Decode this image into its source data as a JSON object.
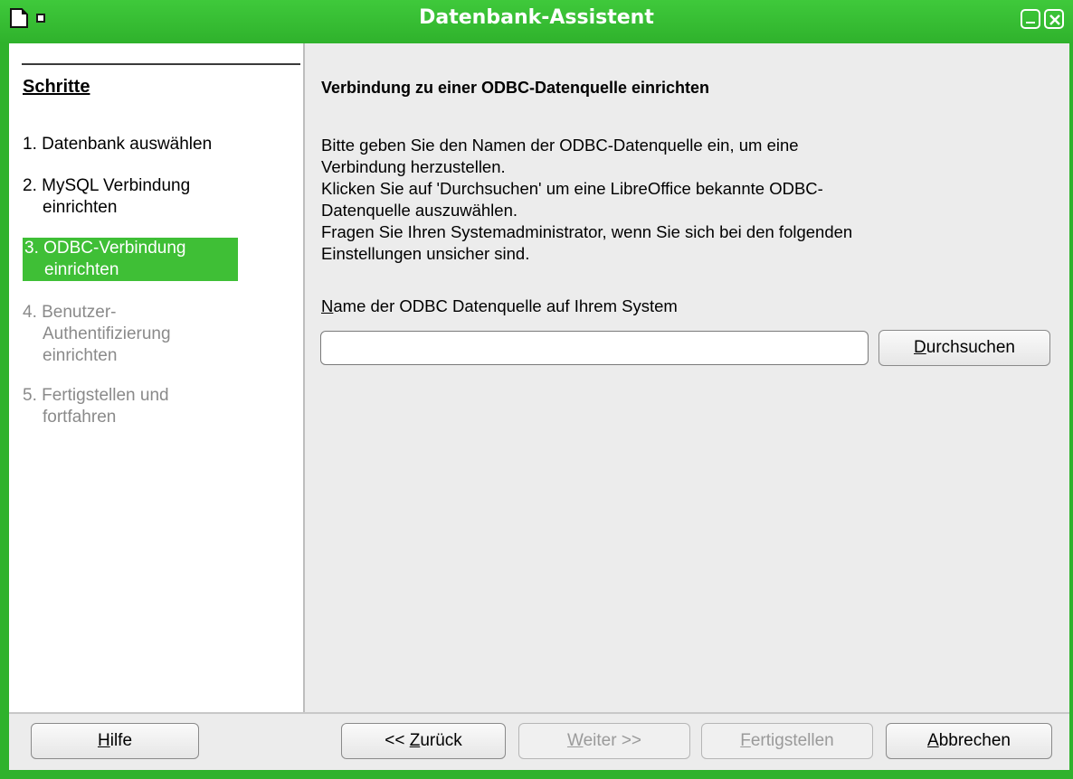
{
  "window": {
    "title": "Datenbank-Assistent"
  },
  "sidebar": {
    "title": "Schritte",
    "steps": [
      {
        "line1": "1. Datenbank auswählen",
        "line2": "",
        "line3": "",
        "state": "done"
      },
      {
        "line1": "2. MySQL Verbindung",
        "line2": "einrichten",
        "line3": "",
        "state": "done"
      },
      {
        "line1": "3. ODBC-Verbindung",
        "line2": "einrichten",
        "line3": "",
        "state": "active"
      },
      {
        "line1": "4. Benutzer-",
        "line2": "Authentifizierung",
        "line3": "einrichten",
        "state": "disabled"
      },
      {
        "line1": "5. Fertigstellen und",
        "line2": "fortfahren",
        "line3": "",
        "state": "disabled"
      }
    ]
  },
  "main": {
    "title": "Verbindung zu einer ODBC-Datenquelle einrichten",
    "description_lines": [
      "Bitte geben Sie den Namen der ODBC-Datenquelle ein, um eine",
      "Verbindung herzustellen.",
      "Klicken Sie auf 'Durchsuchen' um eine LibreOffice bekannte ODBC-",
      "Datenquelle auszuwählen.",
      "Fragen Sie Ihren Systemadministrator, wenn Sie sich bei den folgenden",
      "Einstellungen unsicher sind."
    ],
    "field_label_mnemonic": "N",
    "field_label_rest": "ame der ODBC Datenquelle auf Ihrem System",
    "field_value": "",
    "browse_mnemonic": "D",
    "browse_rest": "urchsuchen"
  },
  "footer": {
    "help_mnemonic": "H",
    "help_rest": "ilfe",
    "back_prefix": "<< ",
    "back_mnemonic": "Z",
    "back_rest": "urück",
    "next_mnemonic": "W",
    "next_rest": "eiter >>",
    "finish_mnemonic": "F",
    "finish_rest": "ertigstellen",
    "cancel_mnemonic": "A",
    "cancel_rest": "bbrechen"
  },
  "colors": {
    "accent": "#2fb22c",
    "active_step": "#3fbf36",
    "disabled_text": "#8a8a8a"
  },
  "icons": [
    "libreoffice-document-icon",
    "window-menu-icon",
    "minimize-icon",
    "close-icon"
  ]
}
